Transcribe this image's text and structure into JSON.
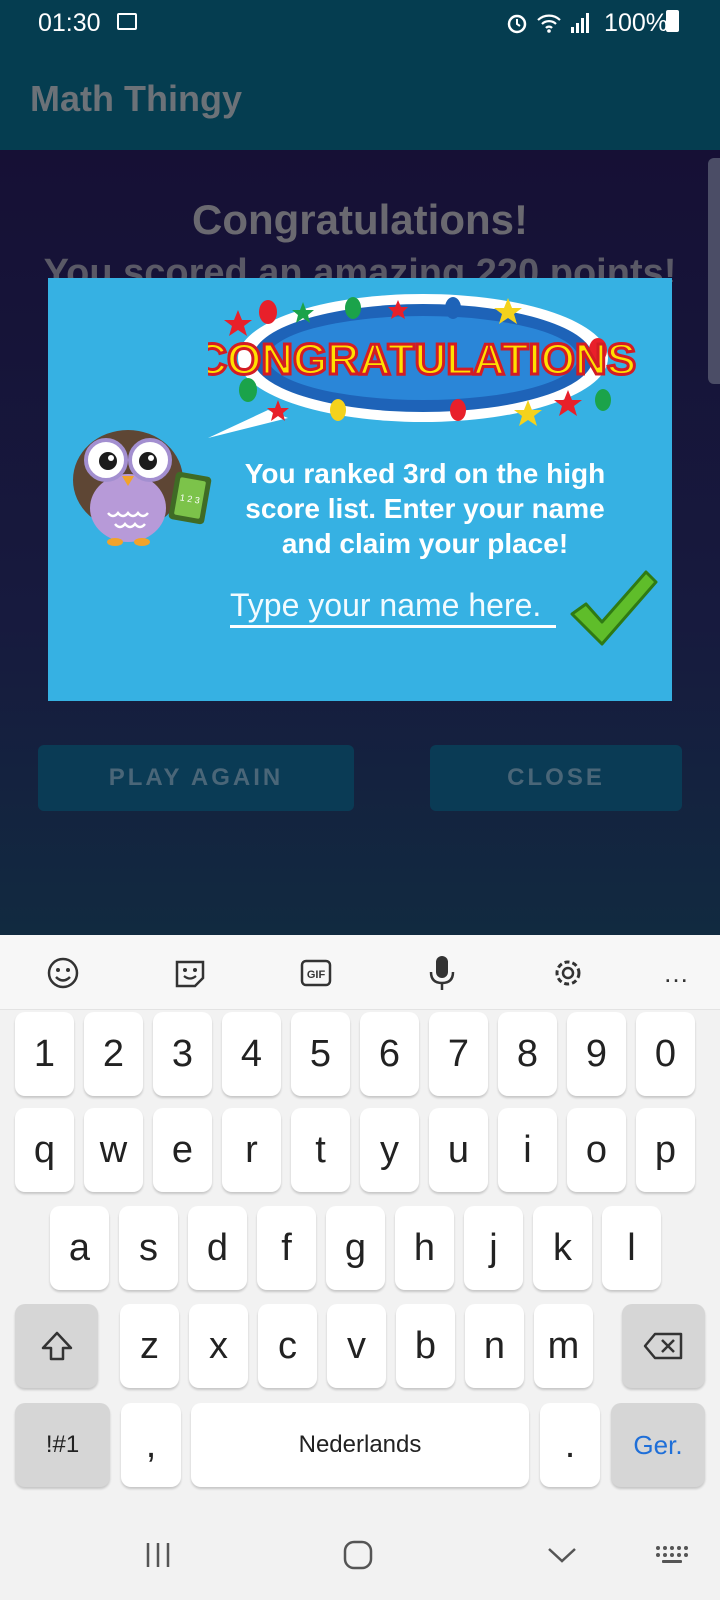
{
  "status_bar": {
    "time": "01:30",
    "battery": "100%"
  },
  "app": {
    "title": "Math Thingy"
  },
  "background": {
    "heading": "Congratulations!",
    "subheading": "You scored an amazing 220 points!",
    "play_again_label": "PLAY AGAIN",
    "close_label": "CLOSE"
  },
  "dialog": {
    "badge_text": "CONGRATULATIONS!",
    "message": "You ranked 3rd on the high score list. Enter your name and claim your place!",
    "name_placeholder": "Type your name here.",
    "owl_card": "1 2 3"
  },
  "keyboard": {
    "toolbar": [
      "emoji-icon",
      "sticker-icon",
      "gif-icon",
      "microphone-icon",
      "settings-icon",
      "more-icon"
    ],
    "gif_label": "GIF",
    "more_label": "…",
    "row_numbers": [
      "1",
      "2",
      "3",
      "4",
      "5",
      "6",
      "7",
      "8",
      "9",
      "0"
    ],
    "row1": [
      "q",
      "w",
      "e",
      "r",
      "t",
      "y",
      "u",
      "i",
      "o",
      "p"
    ],
    "row2": [
      "a",
      "s",
      "d",
      "f",
      "g",
      "h",
      "j",
      "k",
      "l"
    ],
    "row3": [
      "z",
      "x",
      "c",
      "v",
      "b",
      "n",
      "m"
    ],
    "symbols_label": "!#1",
    "comma": ",",
    "space_label": "Nederlands",
    "period": ".",
    "action_label": "Ger."
  },
  "colors": {
    "app_bar": "#053d50",
    "dialog": "#36b1e3",
    "action_blue": "#1f6fd8"
  }
}
